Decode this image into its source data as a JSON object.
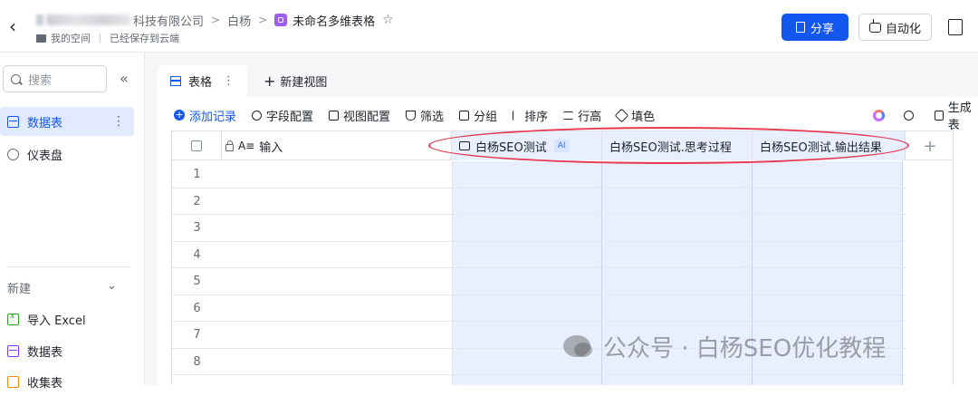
{
  "header": {
    "breadcrumb": {
      "company": "科技有限公司",
      "folder": "白杨",
      "doc_title": "未命名多维表格"
    },
    "sub": {
      "space": "我的空间",
      "save_status": "已经保存到云端"
    },
    "share_label": "分享",
    "automation_label": "自动化"
  },
  "sidebar": {
    "search_placeholder": "搜索",
    "items": [
      {
        "label": "数据表"
      },
      {
        "label": "仪表盘"
      }
    ],
    "new_section": "新建",
    "new_items": [
      {
        "label": "导入 Excel"
      },
      {
        "label": "数据表"
      },
      {
        "label": "收集表"
      }
    ]
  },
  "tabs": {
    "active_tab": "表格",
    "new_view": "新建视图"
  },
  "toolbar": {
    "add_record": "添加记录",
    "field_config": "字段配置",
    "view_config": "视图配置",
    "filter": "筛选",
    "group": "分组",
    "sort": "排序",
    "row_height": "行高",
    "fill_color": "填色",
    "generate": "生成表"
  },
  "grid": {
    "columns": [
      {
        "label": "输入"
      },
      {
        "label": "白杨SEO测试",
        "badge": "AI"
      },
      {
        "label": "白杨SEO测试.思考过程"
      },
      {
        "label": "白杨SEO测试.输出结果"
      }
    ],
    "rows": [
      "1",
      "2",
      "3",
      "4",
      "5",
      "6",
      "7",
      "8",
      ""
    ]
  },
  "watermark": "公众号 · 白杨SEO优化教程",
  "colors": {
    "accent": "#1456f0",
    "selected_column": "#e8efff",
    "annotation": "#e8384f"
  }
}
